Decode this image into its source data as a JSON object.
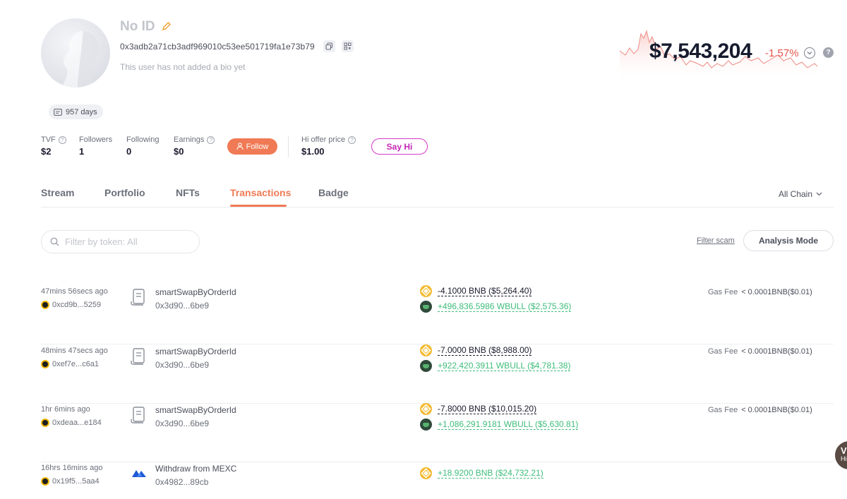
{
  "profile": {
    "username": "No ID",
    "address": "0x3adb2a71cb3adf969010c53ee501719fa1e73b79",
    "bio": "This user has not added a bio yet",
    "days": "957 days"
  },
  "net_worth": {
    "value": "$7,543,204",
    "change": "-1.57%",
    "change_color": "#e5534b"
  },
  "stats": {
    "tvf": {
      "label": "TVF",
      "value": "$2"
    },
    "followers": {
      "label": "Followers",
      "value": "1"
    },
    "following": {
      "label": "Following",
      "value": "0"
    },
    "earnings": {
      "label": "Earnings",
      "value": "$0"
    },
    "hi_offer": {
      "label": "Hi offer price",
      "value": "$1.00"
    }
  },
  "actions": {
    "follow_label": "Follow",
    "say_hi_label": "Say Hi"
  },
  "tabs": [
    "Stream",
    "Portfolio",
    "NFTs",
    "Transactions",
    "Badge"
  ],
  "active_tab": "Transactions",
  "chain_filter": "All Chain",
  "filter": {
    "placeholder": "Filter by token: All",
    "filter_scam_label": "Filter scam",
    "analysis_mode_label": "Analysis Mode"
  },
  "transactions": [
    {
      "time": "47mins 56secs ago",
      "from": "0xcd9b...5259",
      "method": "smartSwapByOrderId",
      "hash": "0x3d90...6be9",
      "out": "-4.1000 BNB ($5,264.40)",
      "in": "+496,836.5986 WBULL ($2,575.36)",
      "gas_label": "Gas Fee",
      "gas_value": "< 0.0001BNB($0.01)"
    },
    {
      "time": "48mins 47secs ago",
      "from": "0xef7e...c6a1",
      "method": "smartSwapByOrderId",
      "hash": "0x3d90...6be9",
      "out": "-7.0000 BNB ($8,988.00)",
      "in": "+922,420.3911 WBULL ($4,781.38)",
      "gas_label": "Gas Fee",
      "gas_value": "< 0.0001BNB($0.01)"
    },
    {
      "time": "1hr 6mins ago",
      "from": "0xdeaa...e184",
      "method": "smartSwapByOrderId",
      "hash": "0x3d90...6be9",
      "out": "-7.8000 BNB ($10,015.20)",
      "in": "+1,086,291.9181 WBULL ($5,630.81)",
      "gas_label": "Gas Fee",
      "gas_value": "< 0.0001BNB($0.01)"
    },
    {
      "time": "16hrs 16mins ago",
      "from": "0x19f5...5aa4",
      "method": "Withdraw from MEXC",
      "hash": "0x4982...89cb",
      "in": "+18.9200 BNB ($24,732.21)"
    }
  ],
  "side_widget": {
    "line1": "V",
    "line2": "Hi"
  },
  "colors": {
    "accent": "#f07a55",
    "positive": "#3ebd7a",
    "negative": "#e5534b",
    "say_hi": "#c526b8"
  }
}
